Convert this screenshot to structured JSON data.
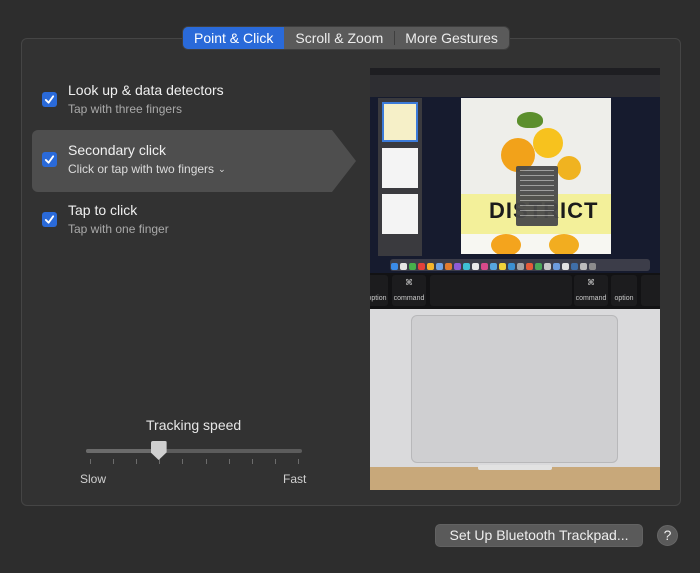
{
  "tabs": [
    {
      "label": "Point & Click",
      "active": true
    },
    {
      "label": "Scroll & Zoom",
      "active": false
    },
    {
      "label": "More Gestures",
      "active": false
    }
  ],
  "options": [
    {
      "title": "Look up & data detectors",
      "subtitle": "Tap with three fingers",
      "checked": true,
      "selected": false
    },
    {
      "title": "Secondary click",
      "subtitle": "Click or tap with two fingers",
      "checked": true,
      "selected": true,
      "has_dropdown": true
    },
    {
      "title": "Tap to click",
      "subtitle": "Tap with one finger",
      "checked": true,
      "selected": false
    }
  ],
  "tracking": {
    "label": "Tracking speed",
    "min_label": "Slow",
    "max_label": "Fast",
    "tick_count": 10,
    "value_fraction": 0.33
  },
  "preview": {
    "doc_headline": "DISTRICT",
    "keys": {
      "left_option": "option",
      "left_command": "command",
      "right_command": "command",
      "right_option": "option",
      "alt_symbol": "alt",
      "cmd_symbol": "⌘"
    }
  },
  "footer": {
    "bluetooth_button": "Set Up Bluetooth Trackpad...",
    "help_button": "?"
  },
  "colors": {
    "accent": "#2a6ad9",
    "panel": "#323232",
    "selected_row": "#4e4e4e"
  }
}
